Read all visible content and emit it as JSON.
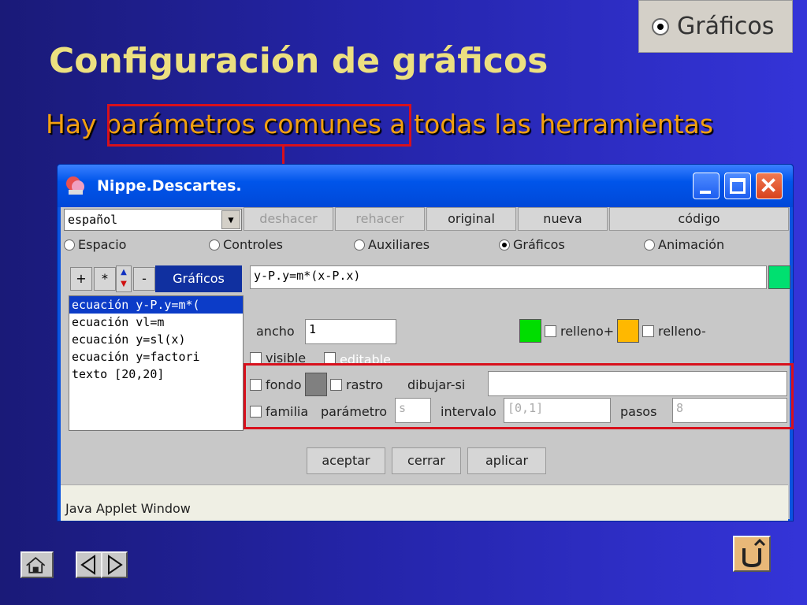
{
  "inset": {
    "label": "Gráficos"
  },
  "slide": {
    "title": "Configuración de gráficos",
    "subtitle_pre": "Hay ",
    "subtitle_hl": "parámetros comunes",
    "subtitle_post": " a todas las herramientas"
  },
  "window": {
    "title": "Nippe.Descartes.",
    "language": "español",
    "toolbar": [
      "deshacer",
      "rehacer",
      "original",
      "nueva",
      "código"
    ],
    "tabs": [
      "Espacio",
      "Controles",
      "Auxiliares",
      "Gráficos",
      "Animación"
    ],
    "selected_tab": "Gráficos",
    "list_buttons": [
      "+",
      "*",
      "-"
    ],
    "list_header": "Gráficos",
    "items": [
      "ecuación y-P.y=m*(",
      "ecuación vl=m",
      "ecuación y=sl(x)",
      "ecuación y=factori",
      "texto [20,20]"
    ],
    "expression": "y-P.y=m*(x-P.x)",
    "ancho_label": "ancho",
    "ancho_value": "1",
    "relleno_plus": "relleno+",
    "relleno_minus": "relleno-",
    "visible": "visible",
    "editable": "editable",
    "fondo": "fondo",
    "rastro": "rastro",
    "dibujar_si": "dibujar-si",
    "dibujar_si_value": "",
    "familia": "familia",
    "parametro": "parámetro",
    "parametro_value": "s",
    "intervalo": "intervalo",
    "intervalo_value": "[0,1]",
    "pasos": "pasos",
    "pasos_value": "8",
    "buttons": [
      "aceptar",
      "cerrar",
      "aplicar"
    ],
    "status": "Java Applet Window"
  },
  "colors": {
    "expr_swatch": "#00e070",
    "relleno_plus": "#00dd00",
    "relleno_minus": "#ffb800",
    "fondo_swatch": "#808080",
    "highlight": "#d8101c"
  }
}
